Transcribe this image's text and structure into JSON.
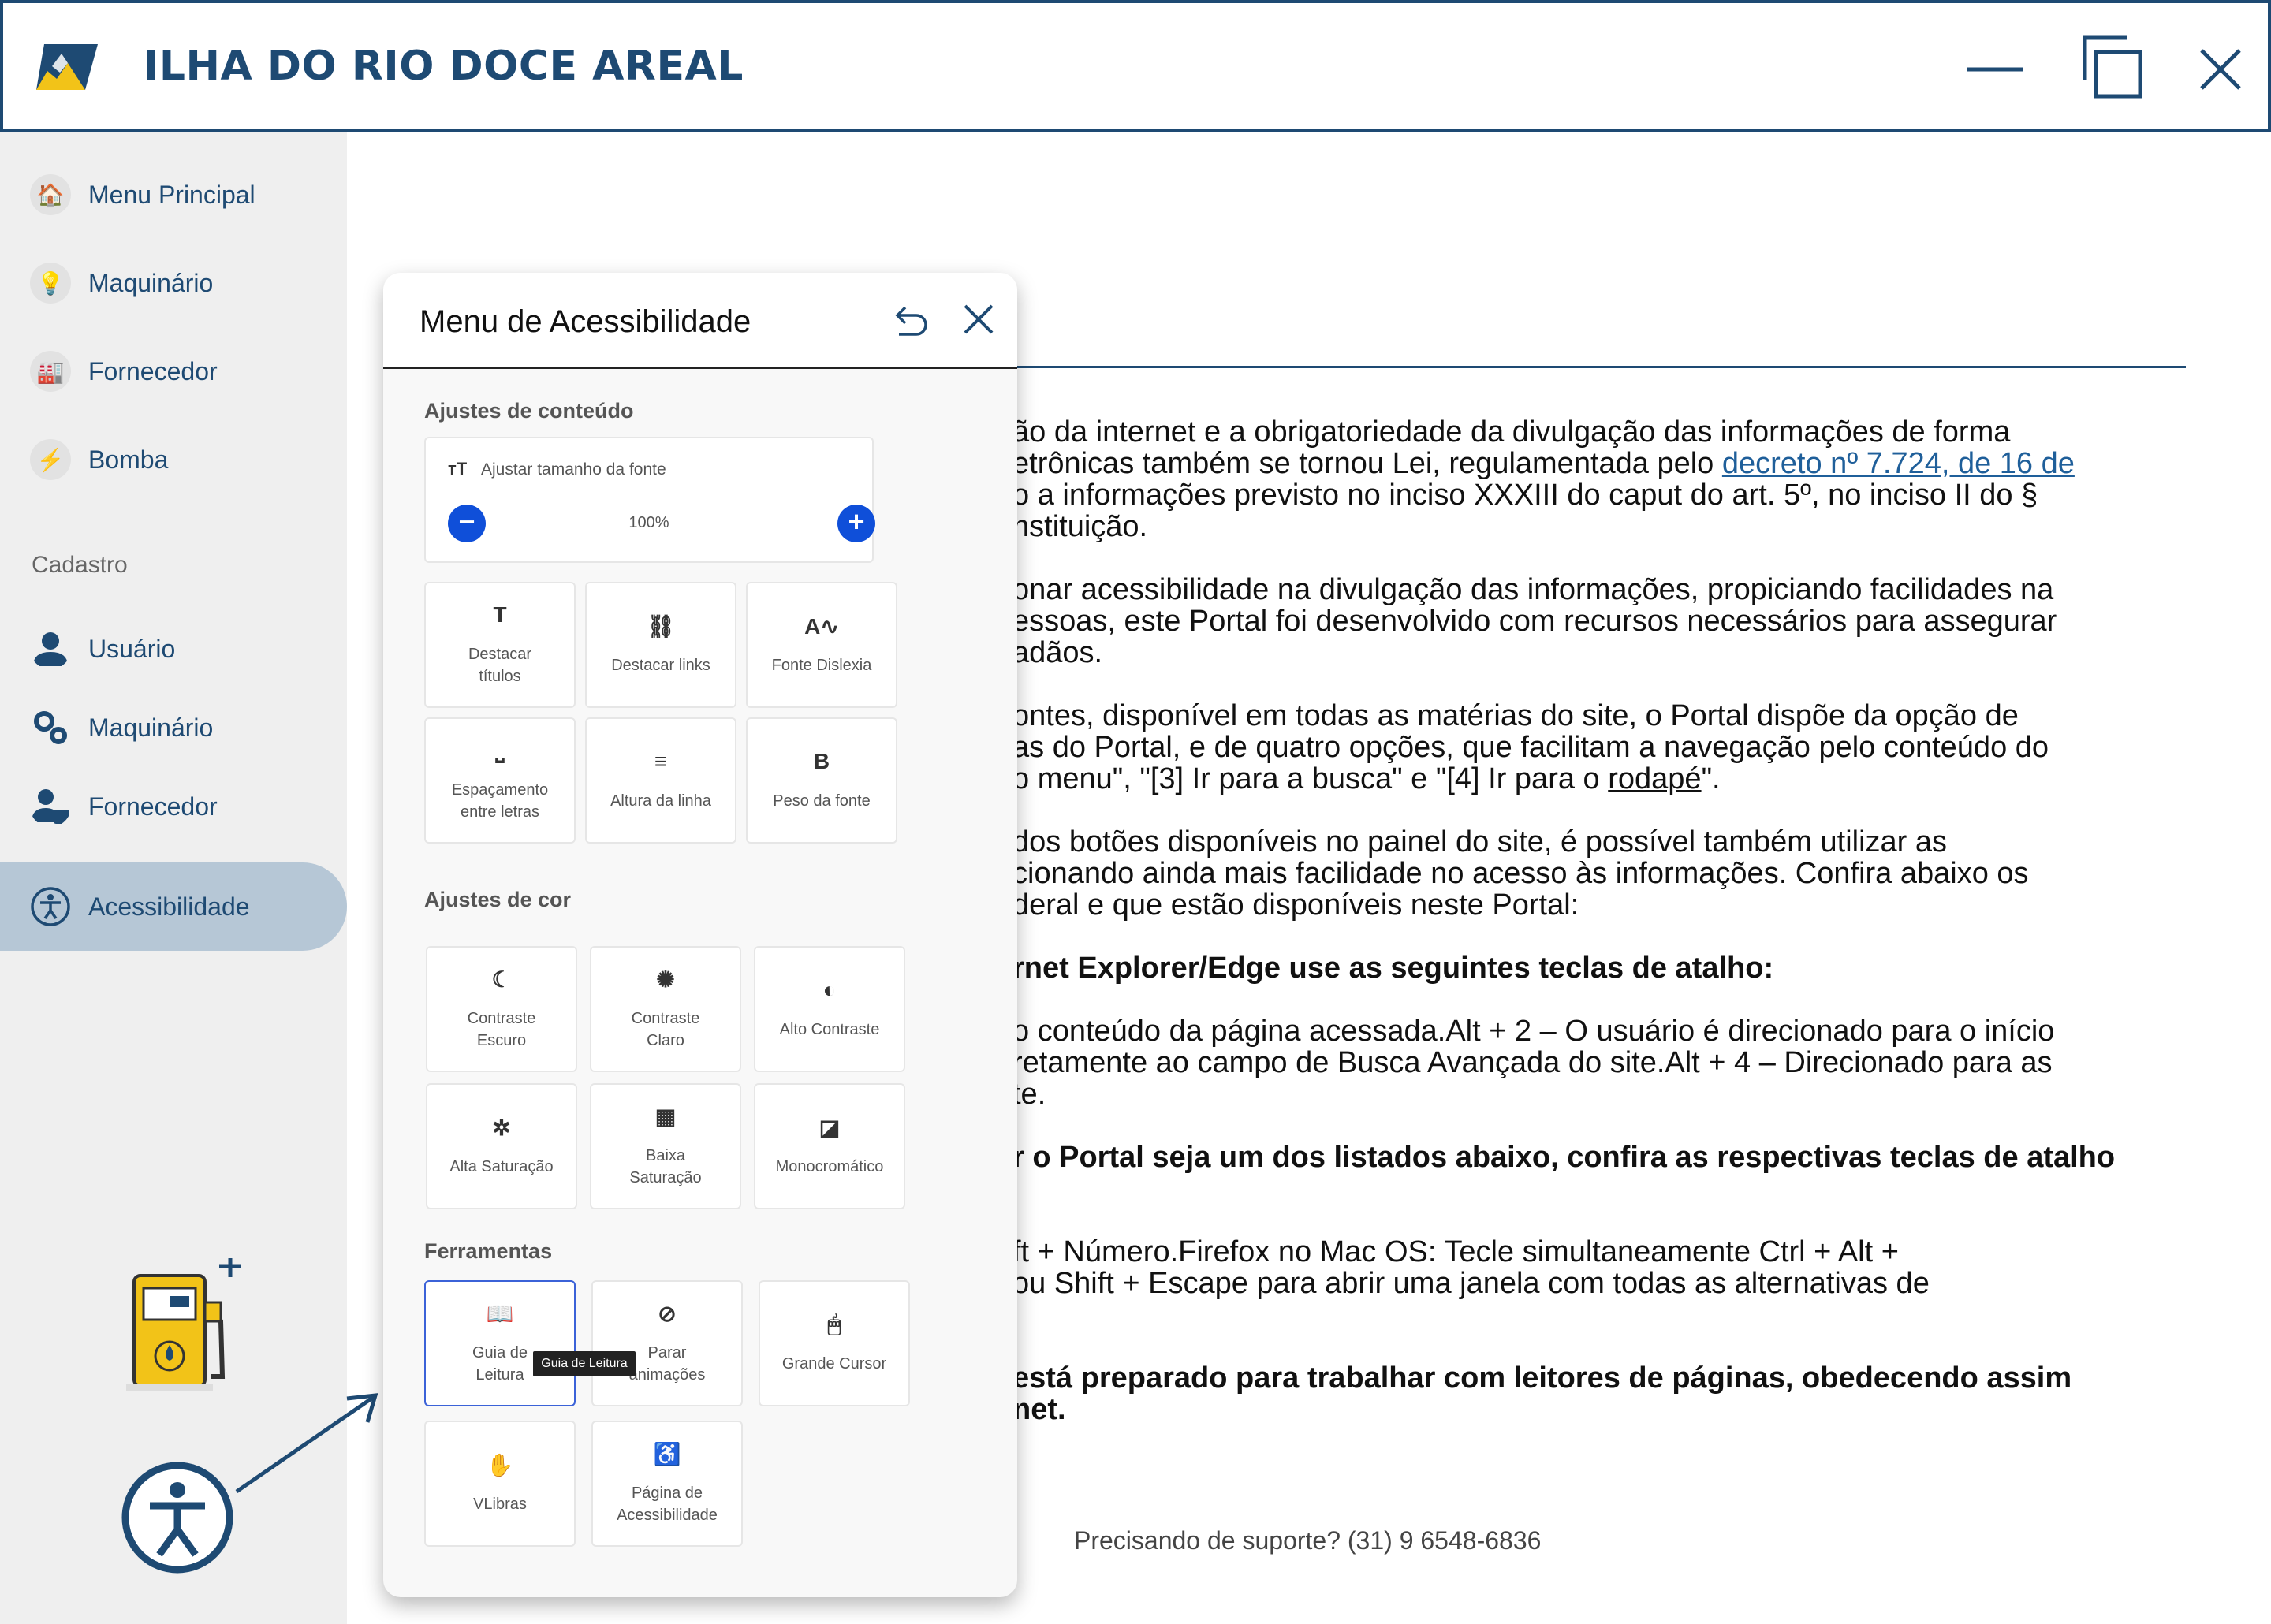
{
  "app": {
    "title": "ILHA DO RIO DOCE AREAL"
  },
  "window_controls": {
    "minimize_icon": "minimize-icon",
    "maximize_icon": "restore-icon",
    "close_icon": "close-icon"
  },
  "sidebar": {
    "items_top": [
      {
        "label": "Menu Principal",
        "icon": "home-icon"
      },
      {
        "label": "Maquinário",
        "icon": "lightbulb-icon"
      },
      {
        "label": "Fornecedor",
        "icon": "factory-icon"
      },
      {
        "label": "Bomba",
        "icon": "lightning-icon"
      }
    ],
    "section": "Cadastro",
    "items_cadastro": [
      {
        "label": "Usuário",
        "icon": "user-icon"
      },
      {
        "label": "Maquinário",
        "icon": "gears-icon"
      },
      {
        "label": "Fornecedor",
        "icon": "supplier-icon"
      }
    ],
    "active": {
      "label": "Acessibilidade",
      "icon": "accessibility-icon"
    }
  },
  "accessibility_menu": {
    "title": "Menu de Acessibilidade",
    "content_section": "Ajustes de conteúdo",
    "font_size": {
      "label": "Ajustar tamanho da fonte",
      "value": "100%",
      "minus": "−",
      "plus": "+"
    },
    "content_tiles": [
      {
        "label_line1": "Destacar",
        "label_line2": "títulos",
        "glyph": "T"
      },
      {
        "label_line1": "Destacar links",
        "label_line2": "",
        "glyph": "⛓"
      },
      {
        "label_line1": "Fonte Dislexia",
        "label_line2": "",
        "glyph": "A∿"
      },
      {
        "label_line1": "Espaçamento",
        "label_line2": "entre letras",
        "glyph": "⎵"
      },
      {
        "label_line1": "Altura da linha",
        "label_line2": "",
        "glyph": "≡"
      },
      {
        "label_line1": "Peso da fonte",
        "label_line2": "",
        "glyph": "B"
      }
    ],
    "color_section": "Ajustes de cor",
    "color_tiles": [
      {
        "label_line1": "Contraste",
        "label_line2": "Escuro",
        "glyph": "☾"
      },
      {
        "label_line1": "Contraste",
        "label_line2": "Claro",
        "glyph": "✺"
      },
      {
        "label_line1": "Alto Contraste",
        "label_line2": "",
        "glyph": "◐"
      },
      {
        "label_line1": "Alta Saturação",
        "label_line2": "",
        "glyph": "✲"
      },
      {
        "label_line1": "Baixa",
        "label_line2": "Saturação",
        "glyph": "▦"
      },
      {
        "label_line1": "Monocromático",
        "label_line2": "",
        "glyph": "◪"
      }
    ],
    "tools_section": "Ferramentas",
    "tool_tiles": [
      {
        "label_line1": "Guia de",
        "label_line2": "Leitura",
        "glyph": "📖"
      },
      {
        "label_line1": "Parar",
        "label_line2": "animações",
        "glyph": "⊘"
      },
      {
        "label_line1": "Grande Cursor",
        "label_line2": "",
        "glyph": "🖱"
      },
      {
        "label_line1": "VLibras",
        "label_line2": "",
        "glyph": "✋"
      },
      {
        "label_line1": "Página de",
        "label_line2": "Acessibilidade",
        "glyph": "♿"
      }
    ],
    "tooltip": "Guia de Leitura"
  },
  "content": {
    "paragraphs": [
      {
        "lines": [
          "ão da internet e a obrigatoriedade da divulgação das informações de forma",
          "etrônicas também se tornou Lei, regulamentada pelo |decreto nº 7.724, de 16 de",
          "o a informações previsto no inciso XXXIII do caput do art. 5º, no inciso II do §",
          "nstituição."
        ]
      },
      {
        "lines": [
          "onar acessibilidade na divulgação das informações, propiciando facilidades na",
          "essoas, este Portal foi desenvolvido com recursos necessários para assegurar",
          "adãos."
        ]
      },
      {
        "lines": [
          "ontes, disponível em todas as matérias do site, o Portal dispõe da opção de",
          "as do Portal, e de quatro opções, que facilitam a navegação pelo conteúdo do",
          " o menu\", \"[3] Ir para a busca\" e \"[4] Ir para o rodapé\"."
        ]
      },
      {
        "lines": [
          "dos botões disponíveis no painel do site, é possível também utilizar as",
          "cionando ainda mais facilidade no acesso às informações. Confira abaixo os",
          "deral e que estão disponíveis neste Portal:"
        ]
      }
    ],
    "heading1": "rnet Explorer/Edge use as seguintes teclas de atalho:",
    "para5": [
      "o conteúdo da página acessada.Alt + 2 – O usuário é direcionado para o início",
      "retamente ao campo de Busca Avançada do site.Alt + 4 – Direcionado para as",
      "te."
    ],
    "heading2": "r o Portal seja um dos listados abaixo, confira as respectivas teclas de atalho",
    "para6": [
      "ft + Número.Firefox no Mac OS: Tecle simultaneamente Ctrl + Alt +",
      "ou Shift + Escape para abrir uma janela com todas as alternativas de"
    ],
    "heading3": [
      "está preparado para trabalhar com leitores de páginas, obedecendo assim",
      "net."
    ],
    "link_text": "decreto nº 7.724, de 16 de",
    "footer_link": "rodapé",
    "support": "Precisando de suporte? (31) 9 6548-6836"
  },
  "colors": {
    "brand": "#1e4a73",
    "accent": "#0f4fd9",
    "active_bg": "#b6c7d6"
  }
}
